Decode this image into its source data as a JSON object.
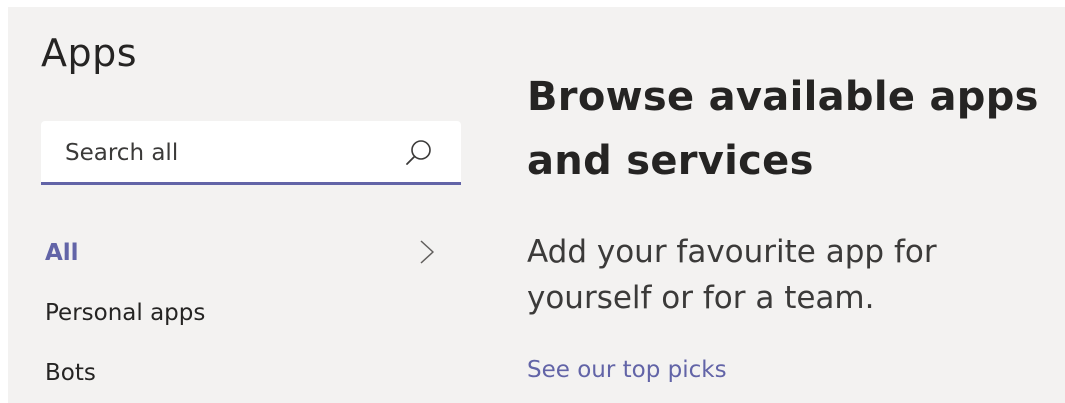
{
  "sidebar": {
    "title": "Apps",
    "search": {
      "placeholder": "Search all",
      "value": "",
      "icon": "search-icon"
    },
    "nav": [
      {
        "label": "All",
        "active": true,
        "icon": "chevron-right-icon"
      },
      {
        "label": "Personal apps",
        "active": false
      },
      {
        "label": "Bots",
        "active": false
      }
    ]
  },
  "main": {
    "heading": "Browse available apps and services",
    "description": "Add your favourite app for yourself or for a team.",
    "link": "See our top picks"
  },
  "colors": {
    "accent": "#6264a7",
    "background": "#f3f2f1",
    "text": "#252423"
  }
}
